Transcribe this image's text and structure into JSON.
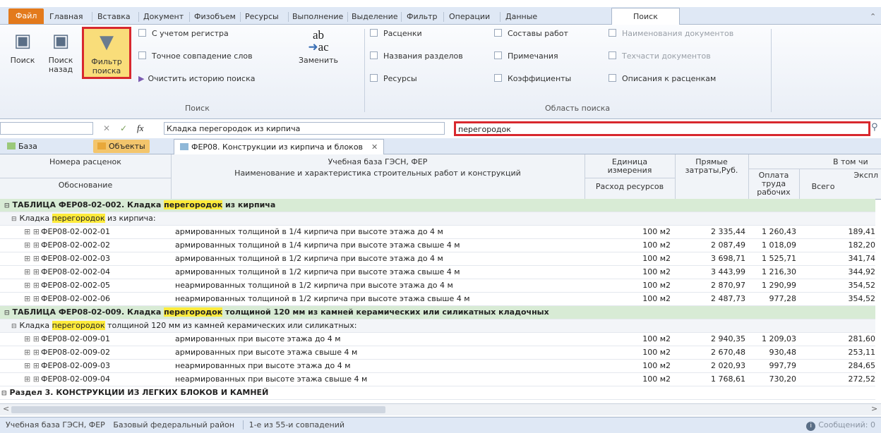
{
  "ribbon_tabs": [
    "Файл",
    "Главная",
    "Вставка",
    "Документ",
    "Физобъем",
    "Ресурсы",
    "Выполнение",
    "Выделение",
    "Фильтр",
    "Операции",
    "Данные",
    "Поиск"
  ],
  "ribbon": {
    "search_btn": "Поиск",
    "search_back_btn": [
      "Поиск",
      "назад"
    ],
    "filter_btn": [
      "Фильтр",
      "поиска"
    ],
    "case_sensitive": "С учетом регистра",
    "whole_word": "Точное совпадение слов",
    "clear_history": "Очистить историю поиска",
    "replace_btn": "Заменить",
    "group_search": "Поиск",
    "area_items": [
      "Расценки",
      "Названия разделов",
      "Ресурсы",
      "Составы работ",
      "Примечания",
      "Коэффициенты",
      "Наименования документов",
      "Техчасти документов",
      "Описания к расценкам"
    ],
    "group_area": "Область поиска"
  },
  "formula_bar": {
    "fx": "fx",
    "value": "Кладка перегородок из кирпича",
    "search_value": "перегородок"
  },
  "doc_tabs": {
    "base": "База",
    "objects": "Объекты",
    "doc": "ФЕР08. Конструкции из кирпича и блоков"
  },
  "grid": {
    "h_numbers": "Номера расценок",
    "h_base": "Учебная база ГЭСН, ФЕР",
    "h_name": "Наименование и характеристика строительных работ и конструкций",
    "h_unit": [
      "Единица",
      "измерения"
    ],
    "h_direct": [
      "Прямые",
      "затраты,Руб."
    ],
    "h_incl": "В том чи",
    "h_pay": [
      "Оплата",
      "труда",
      "рабочих"
    ],
    "h_expl": "Экспл",
    "h_basis": "Обоснование",
    "h_res": "Расход ресурсов",
    "h_total": "Всего"
  },
  "table1": {
    "pre": "ТАБЛИЦА ФЕР08-02-002. Кладка ",
    "hl": "перегородок",
    "post": " из кирпича"
  },
  "sub1": {
    "pre": "Кладка ",
    "hl": "перегородок",
    "post": " из кирпича:"
  },
  "rows1": [
    {
      "code": "ФЕР08-02-002-01",
      "name": "армированных толщиной в 1/4 кирпича при высоте этажа до 4 м",
      "unit": "100 м2",
      "direct": "2 335,44",
      "pay": "1 260,43",
      "expl": "189,41"
    },
    {
      "code": "ФЕР08-02-002-02",
      "name": "армированных толщиной в 1/4 кирпича при высоте этажа свыше 4 м",
      "unit": "100 м2",
      "direct": "2 087,49",
      "pay": "1 018,09",
      "expl": "182,20"
    },
    {
      "code": "ФЕР08-02-002-03",
      "name": "армированных толщиной в 1/2 кирпича при высоте этажа до 4 м",
      "unit": "100 м2",
      "direct": "3 698,71",
      "pay": "1 525,71",
      "expl": "341,74"
    },
    {
      "code": "ФЕР08-02-002-04",
      "name": "армированных толщиной в 1/2 кирпича при высоте этажа свыше 4 м",
      "unit": "100 м2",
      "direct": "3 443,99",
      "pay": "1 216,30",
      "expl": "344,92"
    },
    {
      "code": "ФЕР08-02-002-05",
      "name": "неармированных толщиной в 1/2 кирпича при высоте этажа до 4 м",
      "unit": "100 м2",
      "direct": "2 870,97",
      "pay": "1 290,99",
      "expl": "354,52"
    },
    {
      "code": "ФЕР08-02-002-06",
      "name": "неармированных толщиной в 1/2 кирпича при высоте этажа свыше 4 м",
      "unit": "100 м2",
      "direct": "2 487,73",
      "pay": "977,28",
      "expl": "354,52"
    }
  ],
  "table2": {
    "pre": "ТАБЛИЦА ФЕР08-02-009. Кладка ",
    "hl": "перегородок",
    "post": " толщиной 120 мм из камней керамических или силикатных кладочных"
  },
  "sub2": {
    "pre": "Кладка ",
    "hl": "перегородок",
    "post": " толщиной 120 мм из камней керамических или силикатных:"
  },
  "rows2": [
    {
      "code": "ФЕР08-02-009-01",
      "name": "армированных при высоте этажа до 4 м",
      "unit": "100 м2",
      "direct": "2 940,35",
      "pay": "1 209,03",
      "expl": "281,60"
    },
    {
      "code": "ФЕР08-02-009-02",
      "name": "армированных при высоте этажа свыше 4 м",
      "unit": "100 м2",
      "direct": "2 670,48",
      "pay": "930,48",
      "expl": "253,11"
    },
    {
      "code": "ФЕР08-02-009-03",
      "name": "неармированных при высоте этажа до 4 м",
      "unit": "100 м2",
      "direct": "2 020,93",
      "pay": "997,79",
      "expl": "284,65"
    },
    {
      "code": "ФЕР08-02-009-04",
      "name": "неармированных при высоте этажа свыше 4 м",
      "unit": "100 м2",
      "direct": "1 768,61",
      "pay": "730,20",
      "expl": "272,52"
    }
  ],
  "section3": "Раздел 3. КОНСТРУКЦИИ ИЗ ЛЕГКИХ БЛОКОВ И КАМНЕЙ",
  "status": {
    "base": "Учебная база ГЭСН, ФЕР",
    "region": "Базовый федеральный район",
    "match": "1-е из 55-и совпадений",
    "messages": "Сообщений: 0"
  },
  "colors": {
    "file_tab": "#e37a1c",
    "highlight": "#ffeb3b",
    "table_row": "#d8ebd5",
    "red_frame": "#d8282e"
  }
}
